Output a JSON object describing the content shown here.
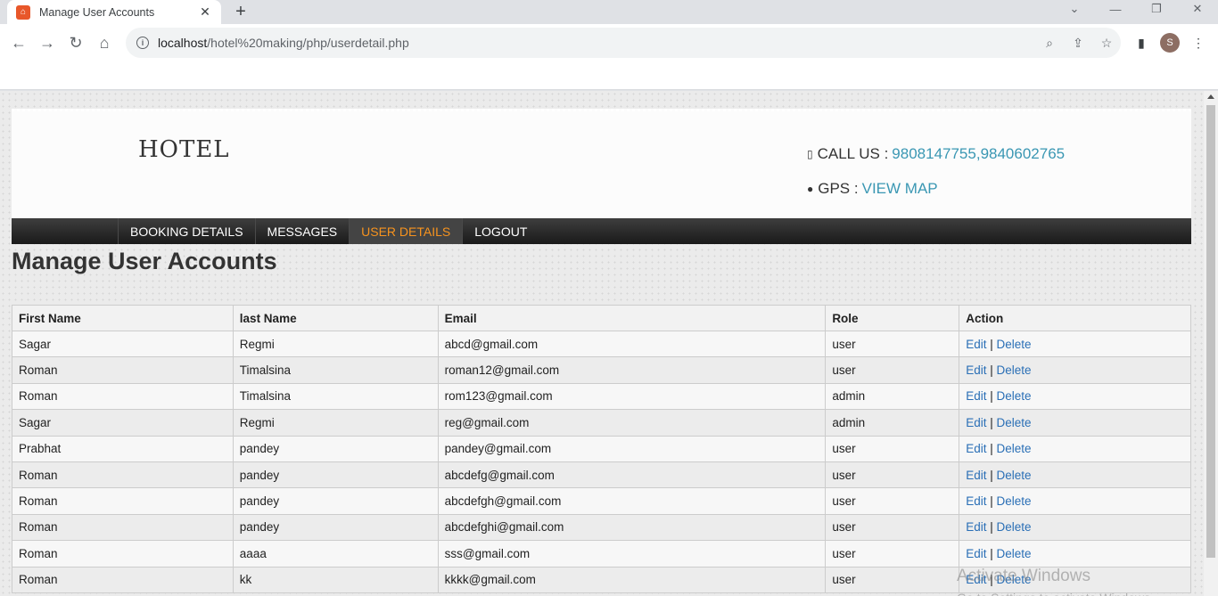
{
  "browser": {
    "tab_title": "Manage User Accounts",
    "url_host": "localhost",
    "url_path": "/hotel%20making/php/userdetail.php",
    "avatar_letter": "S"
  },
  "site": {
    "logo": "HOTEL",
    "call_label": "CALL US :",
    "call_value": "9808147755,9840602765",
    "gps_label": "GPS :",
    "gps_value": "VIEW MAP"
  },
  "nav": [
    "BOOKING DETAILS",
    "MESSAGES",
    "USER DETAILS",
    "LOGOUT"
  ],
  "nav_active": "USER DETAILS",
  "page_title": "Manage User Accounts",
  "table": {
    "headers": [
      "First Name",
      "last Name",
      "Email",
      "Role",
      "Action"
    ],
    "edit_label": "Edit",
    "delete_label": "Delete",
    "rows": [
      [
        "Sagar",
        "Regmi",
        "abcd@gmail.com",
        "user"
      ],
      [
        "Roman",
        "Timalsina",
        "roman12@gmail.com",
        "user"
      ],
      [
        "Roman",
        "Timalsina",
        "rom123@gmail.com",
        "admin"
      ],
      [
        "Sagar",
        "Regmi",
        "reg@gmail.com",
        "admin"
      ],
      [
        "Prabhat",
        "pandey",
        "pandey@gmail.com",
        "user"
      ],
      [
        "Roman",
        "pandey",
        "abcdefg@gmail.com",
        "user"
      ],
      [
        "Roman",
        "pandey",
        "abcdefgh@gmail.com",
        "user"
      ],
      [
        "Roman",
        "pandey",
        "abcdefghi@gmail.com",
        "user"
      ],
      [
        "Roman",
        "aaaa",
        "sss@gmail.com",
        "user"
      ],
      [
        "Roman",
        "kk",
        "kkkk@gmail.com",
        "user"
      ]
    ]
  },
  "watermark": {
    "line1": "Activate Windows",
    "line2": "Go to Settings to activate Windows."
  },
  "colors": {
    "link": "#2a6fb6",
    "accent": "#3a97b3",
    "nav_active": "#f7931e"
  }
}
